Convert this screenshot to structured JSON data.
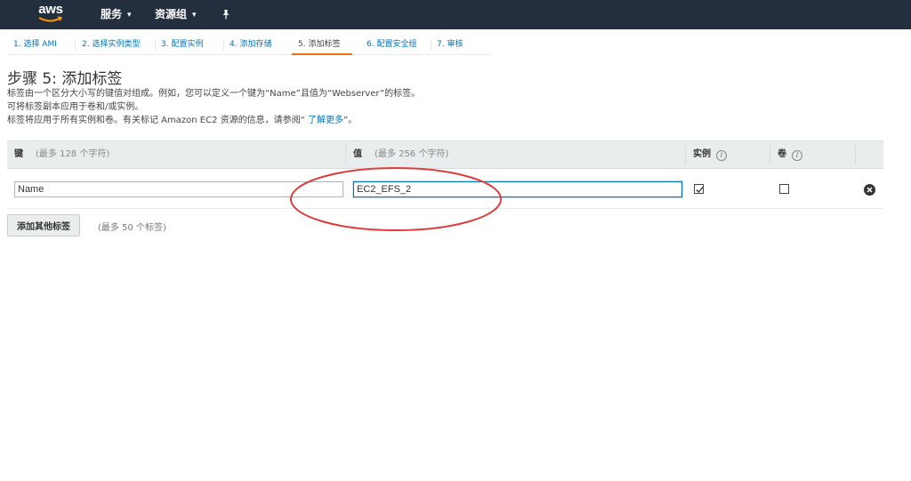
{
  "topbar": {
    "logo_text": "aws",
    "services_label": "服务",
    "resource_groups_label": "资源组",
    "caret": "⌄"
  },
  "wizard_steps": [
    {
      "label": "1. 选择 AMI",
      "active": false
    },
    {
      "label": "2. 选择实例类型",
      "active": false
    },
    {
      "label": "3. 配置实例",
      "active": false
    },
    {
      "label": "4. 添加存储",
      "active": false
    },
    {
      "label": "5. 添加标签",
      "active": true
    },
    {
      "label": "6. 配置安全组",
      "active": false
    },
    {
      "label": "7. 审核",
      "active": false
    }
  ],
  "page": {
    "title": "步骤 5: 添加标签",
    "desc_line1": "标签由一个区分大小写的键值对组成。例如，您可以定义一个键为“Name”且值为“Webserver”的标签。",
    "desc_line2": "可将标签副本应用于卷和/或实例。",
    "desc_line3_prefix": "标签将应用于所有实例和卷。有关标记 Amazon EC2 资源的信息，请参阅“ ",
    "desc_line3_link": "了解更多",
    "desc_line3_suffix": "”。"
  },
  "tag_table": {
    "key_header": "键",
    "key_hint": "(最多 128 个字符)",
    "value_header": "值",
    "value_hint": "(最多 256 个字符)",
    "instances_header": "实例",
    "volumes_header": "卷",
    "info_glyph": "i",
    "rows": [
      {
        "key": "Name",
        "value": "EC2_EFS_2",
        "instances": true,
        "volumes": false
      }
    ]
  },
  "actions": {
    "add_tag_label": "添加其他标签",
    "add_tag_hint": "(最多 50 个标签)"
  },
  "colors": {
    "topbar_bg": "#232f3e",
    "link": "#0073bb",
    "active_step_underline": "#ec7211",
    "annotation": "#e03c3c"
  }
}
